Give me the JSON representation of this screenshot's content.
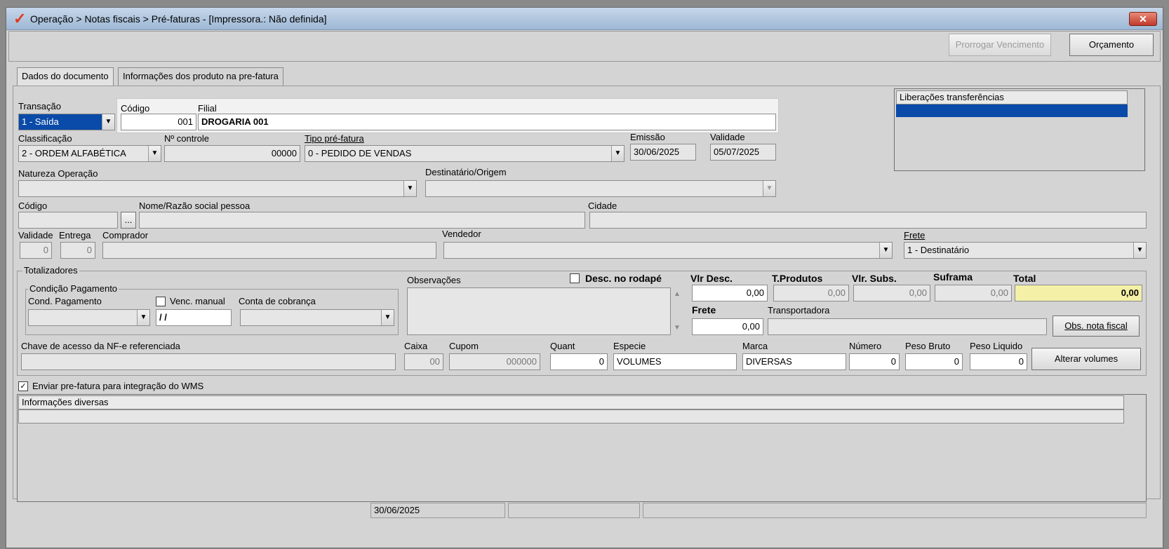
{
  "window": {
    "title": "Operação > Notas fiscais > Pré-faturas - [Impressora.: Não definida]",
    "close": "✕"
  },
  "toolbar": {
    "prorrogar": "Prorrogar Vencimento",
    "orcamento": "Orçamento"
  },
  "tabs": [
    "Dados do documento",
    "Informações dos produto na pre-fatura"
  ],
  "top": {
    "transacao_label": "Transação",
    "transacao_value": "1 - Saída",
    "codigo_label": "Código",
    "codigo_value": "001",
    "filial_label": "Filial",
    "filial_value": "DROGARIA 001",
    "liberacoes_label": "Liberações transferências"
  },
  "row2": {
    "classificacao_label": "Classificação",
    "classificacao_value": "2 - ORDEM ALFABÉTICA",
    "controle_label": "Nº controle",
    "controle_value": "00000",
    "tipo_label": "Tipo pré-fatura",
    "tipo_value": "0  - PEDIDO DE VENDAS",
    "emissao_label": "Emissão",
    "emissao_value": "30/06/2025",
    "validade_label": "Validade",
    "validade_value": "05/07/2025"
  },
  "row3": {
    "natureza_label": "Natureza  Operação",
    "destinatario_label": "Destinatário/Origem"
  },
  "row4": {
    "codigo_label": "Código",
    "ellipsis": "...",
    "nome_label": "Nome/Razão social pessoa",
    "cidade_label": "Cidade"
  },
  "row5": {
    "validade_label": "Validade",
    "validade_value": "0",
    "entrega_label": "Entrega",
    "entrega_value": "0",
    "comprador_label": "Comprador",
    "vendedor_label": "Vendedor",
    "frete_label": "Frete",
    "frete_value": "1 - Destinatário"
  },
  "totalizadores": {
    "label": "Totalizadores",
    "condicao_label": "Condição Pagamento",
    "cond_pagamento_label": "Cond. Pagamento",
    "venc_manual_label": "Venc. manual",
    "venc_value": "/ /",
    "conta_label": "Conta de cobrança",
    "observacoes_label": "Observações",
    "desc_rodape_label": "Desc. no rodapé",
    "vlr_desc_label": "Vlr Desc.",
    "vlr_desc_value": "0,00",
    "tprodutos_label": "T.Produtos",
    "tprodutos_value": "0,00",
    "vlr_subs_label": "Vlr. Subs.",
    "vlr_subs_value": "0,00",
    "suframa_label": "Suframa",
    "suframa_value": "0,00",
    "total_label": "Total",
    "total_value": "0,00",
    "frete_label": "Frete",
    "frete_value": "0,00",
    "transportadora_label": "Transportadora",
    "obs_nota_button": "Obs. nota fiscal",
    "chave_label": "Chave de acesso da NF-e referenciada",
    "caixa_label": "Caixa",
    "caixa_value": "00",
    "cupom_label": "Cupom",
    "cupom_value": "000000",
    "quant_label": "Quant",
    "quant_value": "0",
    "especie_label": "Especie",
    "especie_value": "VOLUMES",
    "marca_label": "Marca",
    "marca_value": "DIVERSAS",
    "numero_label": "Número",
    "numero_value": "0",
    "peso_bruto_label": "Peso Bruto",
    "peso_bruto_value": "0",
    "peso_liquido_label": "Peso Liquido",
    "peso_liquido_value": "0",
    "alterar_volumes_button": "Alterar volumes"
  },
  "wms": {
    "checked": "✓",
    "label": "Enviar pre-fatura para integração do WMS"
  },
  "info": {
    "label": "Informações diversas"
  },
  "statusbar": {
    "date": "30/06/2025"
  },
  "icons": {
    "dropdown": "▼",
    "scroll_up": "▲",
    "scroll_down": "▼"
  }
}
